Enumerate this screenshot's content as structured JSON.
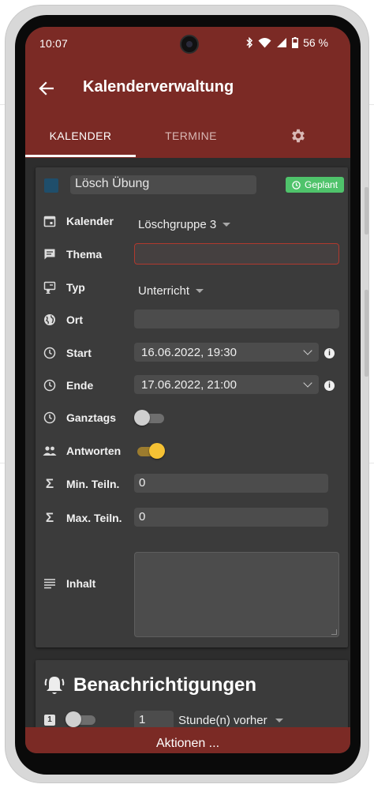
{
  "statusbar": {
    "time": "10:07",
    "battery": "56 %"
  },
  "appbar": {
    "title": "Kalenderverwaltung"
  },
  "tabs": [
    {
      "label": "KALENDER"
    },
    {
      "label": "TERMINE"
    }
  ],
  "event": {
    "title": "Lösch Übung",
    "status": "Geplant",
    "color": "#1f4e6b"
  },
  "fields": {
    "kalender": {
      "label": "Kalender",
      "value": "Löschgruppe 3"
    },
    "thema": {
      "label": "Thema",
      "value": ""
    },
    "typ": {
      "label": "Typ",
      "value": "Unterricht"
    },
    "ort": {
      "label": "Ort",
      "value": ""
    },
    "start": {
      "label": "Start",
      "value": "16.06.2022, 19:30"
    },
    "ende": {
      "label": "Ende",
      "value": "17.06.2022, 21:00"
    },
    "ganztags": {
      "label": "Ganztags",
      "on": false
    },
    "antworten": {
      "label": "Antworten",
      "on": true
    },
    "min_teiln": {
      "label": "Min. Teiln.",
      "value": "0"
    },
    "max_teiln": {
      "label": "Max. Teiln.",
      "value": "0"
    },
    "inhalt": {
      "label": "Inhalt",
      "value": ""
    }
  },
  "notifications": {
    "title": "Benachrichtigungen",
    "items": [
      {
        "index": "1",
        "on": false,
        "amount": "1",
        "unit": "Stunde(n) vorher"
      }
    ]
  },
  "actions": {
    "label": "Aktionen ..."
  },
  "colors": {
    "primary": "#7b2a25",
    "surface": "#3b3b3b",
    "accent": "#f6c234",
    "success": "#4fc36b",
    "error": "#b0392e"
  }
}
